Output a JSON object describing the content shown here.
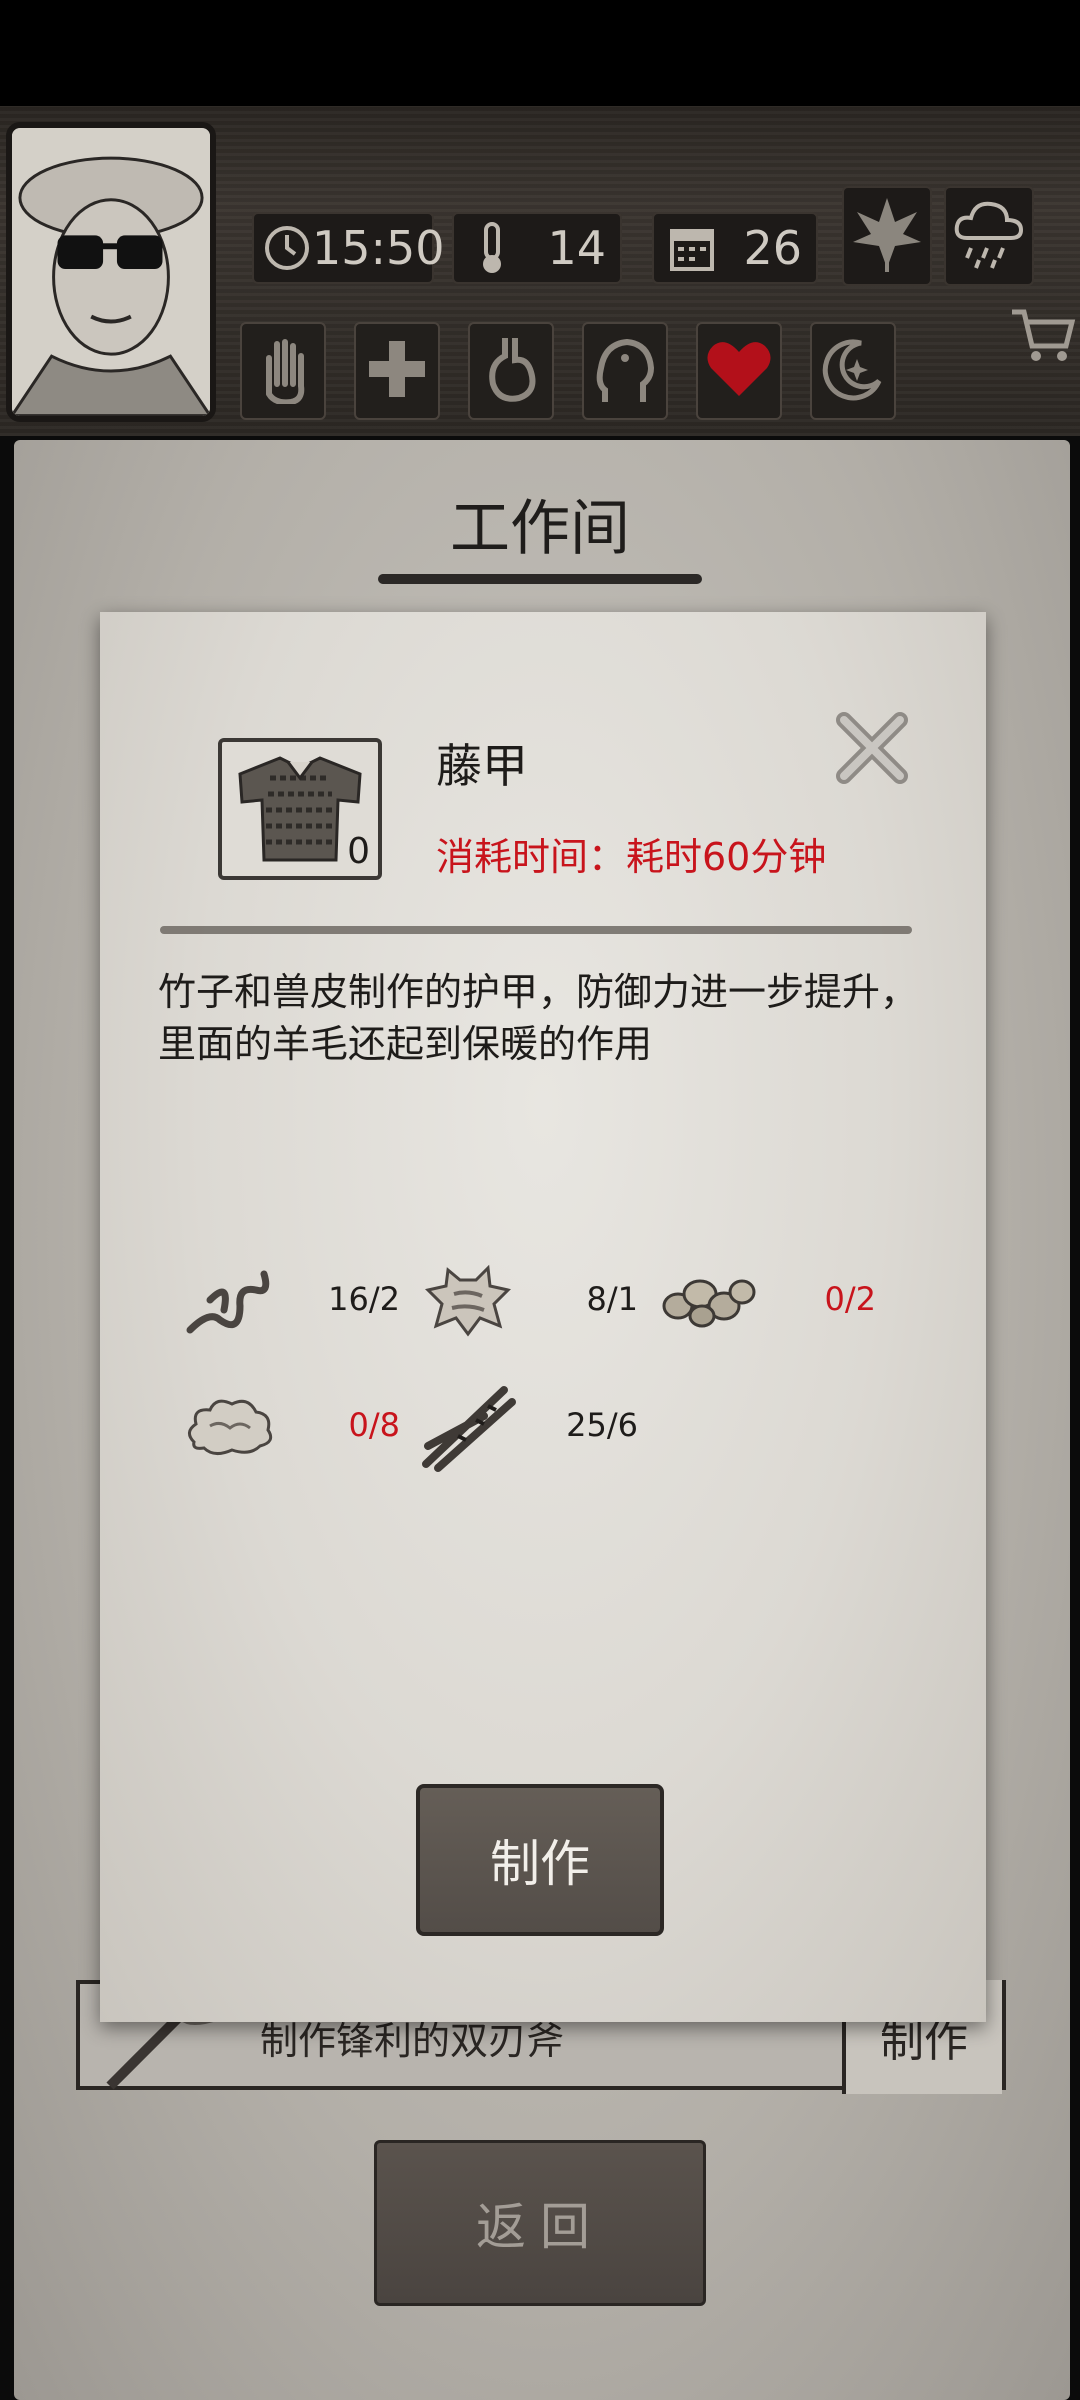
{
  "hud": {
    "time": "15:50",
    "temperature": "14",
    "day": "26",
    "icons": [
      "clock-icon",
      "thermometer-icon",
      "calendar-icon",
      "leaf-icon",
      "rain-cloud-icon"
    ],
    "tools": [
      "hand-icon",
      "medical-cross-icon",
      "stomach-icon",
      "head-icon",
      "heart-icon",
      "moon-icon"
    ]
  },
  "panel": {
    "title": "工作间",
    "bg_row": {
      "description": "制作锋利的双刃斧",
      "button": "制作"
    },
    "back_button": "返回"
  },
  "modal": {
    "item_name": "藤甲",
    "item_count": "0",
    "time_cost": "消耗时间：耗时60分钟",
    "description": "竹子和兽皮制作的护甲，防御力进一步提升，里面的羊毛还起到保暖的作用",
    "materials": [
      {
        "icon": "rope-icon",
        "qty": "16/2",
        "sufficient": true
      },
      {
        "icon": "animal-hide-icon",
        "qty": "8/1",
        "sufficient": true
      },
      {
        "icon": "stones-icon",
        "qty": "0/2",
        "sufficient": false
      },
      {
        "icon": "wool-icon",
        "qty": "0/8",
        "sufficient": false
      },
      {
        "icon": "bamboo-icon",
        "qty": "25/6",
        "sufficient": true
      }
    ],
    "make_button": "制作"
  },
  "colors": {
    "insufficient": "#c8141c",
    "button_dark": "#534d48",
    "parchment": "#dcd9d3"
  }
}
